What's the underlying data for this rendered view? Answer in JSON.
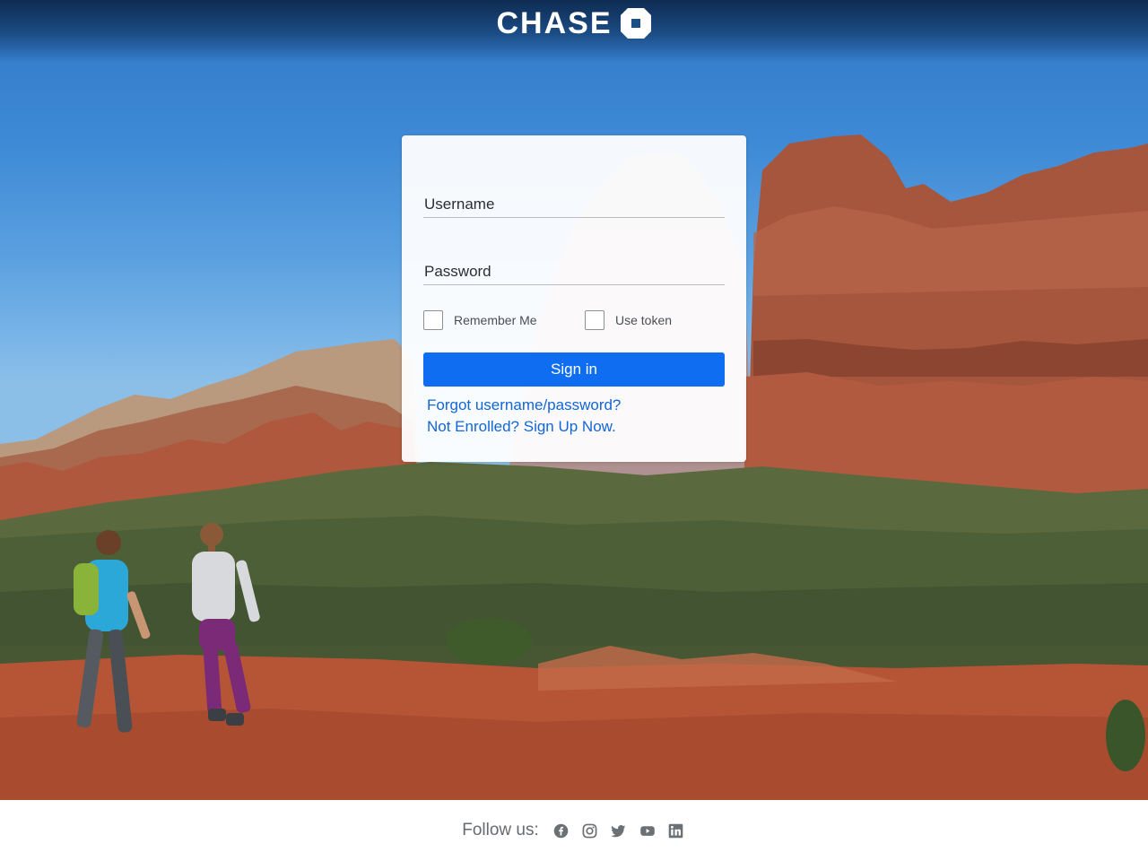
{
  "header": {
    "brand_name": "CHASE"
  },
  "login": {
    "username_placeholder": "Username",
    "password_placeholder": "Password",
    "remember_me_label": "Remember Me",
    "use_token_label": "Use token",
    "signin_label": "Sign in",
    "forgot_link": "Forgot username/password?",
    "enroll_link": "Not Enrolled? Sign Up Now."
  },
  "footer": {
    "follow_label": "Follow us:",
    "social": [
      "facebook-icon",
      "instagram-icon",
      "twitter-icon",
      "youtube-icon",
      "linkedin-icon"
    ]
  },
  "colors": {
    "primary_button": "#0f6df2",
    "link": "#1266d8",
    "sky_top": "#2f77c7",
    "rock_red": "#a7523a"
  }
}
